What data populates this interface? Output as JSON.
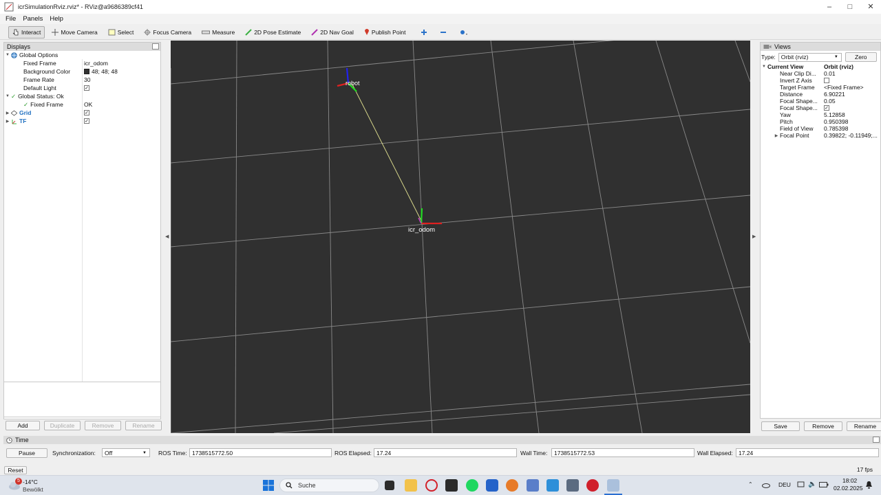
{
  "window": {
    "title": "icrSimulationRviz.rviz* - RViz@a9686389cf41",
    "controls": [
      "minimize",
      "maximize",
      "close"
    ]
  },
  "menu": [
    "File",
    "Panels",
    "Help"
  ],
  "toolbar": {
    "tools": [
      {
        "label": "Interact",
        "icon": "interact-icon"
      },
      {
        "label": "Move Camera",
        "icon": "move-camera-icon"
      },
      {
        "label": "Select",
        "icon": "select-icon"
      },
      {
        "label": "Focus Camera",
        "icon": "focus-camera-icon"
      },
      {
        "label": "Measure",
        "icon": "measure-icon"
      },
      {
        "label": "2D Pose Estimate",
        "icon": "pose-estimate-icon"
      },
      {
        "label": "2D Nav Goal",
        "icon": "nav-goal-icon"
      },
      {
        "label": "Publish Point",
        "icon": "publish-point-icon"
      }
    ]
  },
  "displays": {
    "header": "Displays",
    "rows": [
      {
        "key": "Global Options",
        "value": ""
      },
      {
        "key": "Fixed Frame",
        "value": "icr_odom"
      },
      {
        "key": "Background Color",
        "value": "48; 48; 48"
      },
      {
        "key": "Frame Rate",
        "value": "30"
      },
      {
        "key": "Default Light",
        "value": ""
      },
      {
        "key": "Global Status: Ok",
        "value": ""
      },
      {
        "key": "Fixed Frame",
        "value": "OK"
      },
      {
        "key": "Grid",
        "value": ""
      },
      {
        "key": "TF",
        "value": ""
      }
    ],
    "buttons": {
      "add": "Add",
      "duplicate": "Duplicate",
      "remove": "Remove",
      "rename": "Rename"
    }
  },
  "viewport": {
    "background": "#303030",
    "frame_labels": {
      "robot": "robot",
      "odom": "icr_odom"
    }
  },
  "views": {
    "header": "Views",
    "type_label": "Type:",
    "type_value": "Orbit (rviz)",
    "zero": "Zero",
    "current_view": {
      "key": "Current View",
      "value": "Orbit (rviz)"
    },
    "rows": [
      {
        "key": "Near Clip Di...",
        "value": "0.01"
      },
      {
        "key": "Invert Z Axis",
        "value": ""
      },
      {
        "key": "Target Frame",
        "value": "<Fixed Frame>"
      },
      {
        "key": "Distance",
        "value": "6.90221"
      },
      {
        "key": "Focal Shape...",
        "value": "0.05"
      },
      {
        "key": "Focal Shape...",
        "value": ""
      },
      {
        "key": "Yaw",
        "value": "5.12858"
      },
      {
        "key": "Pitch",
        "value": "0.950398"
      },
      {
        "key": "Field of View",
        "value": "0.785398"
      },
      {
        "key": "Focal Point",
        "value": "0.39822; -0.11949;..."
      }
    ],
    "buttons": {
      "save": "Save",
      "remove": "Remove",
      "rename": "Rename"
    }
  },
  "time": {
    "header": "Time",
    "pause": "Pause",
    "sync_label": "Synchronization:",
    "sync_value": "Off",
    "ros_time_label": "ROS Time:",
    "ros_time": "1738515772.50",
    "ros_elapsed_label": "ROS Elapsed:",
    "ros_elapsed": "17.24",
    "wall_time_label": "Wall Time:",
    "wall_time": "1738515772.53",
    "wall_elapsed_label": "Wall Elapsed:",
    "wall_elapsed": "17.24",
    "reset": "Reset",
    "fps": "17 fps"
  },
  "taskbar": {
    "weather_temp": "-14°C",
    "weather_desc": "Bewölkt",
    "weather_badge": "5",
    "search_placeholder": "Suche",
    "lang": "DEU",
    "time": "18:02",
    "date": "02.02.2025"
  }
}
